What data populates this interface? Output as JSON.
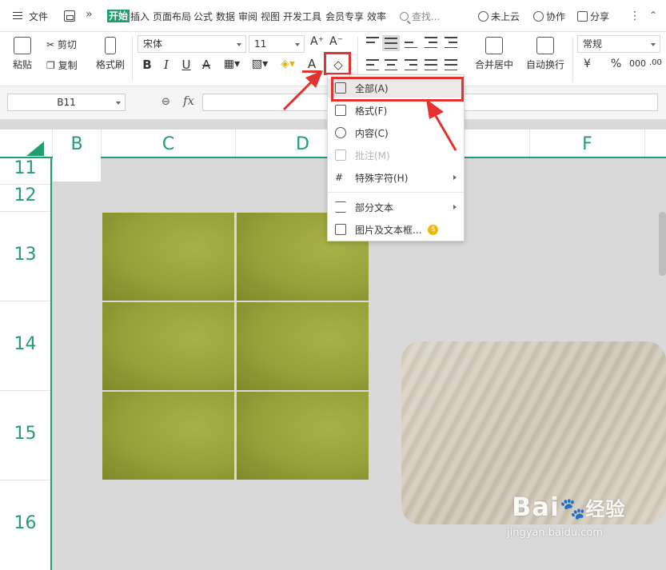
{
  "menubar": {
    "file_label": "文件",
    "more_label": "»",
    "tabs": [
      "开始",
      "插入",
      "页面布局",
      "公式",
      "数据",
      "审阅",
      "视图",
      "开发工具",
      "会员专享",
      "效率"
    ],
    "search_placeholder": "查找...",
    "cloud_label": "未上云",
    "collab_label": "协作",
    "share_label": "分享",
    "kebab": "⋮",
    "collapse": "⌃"
  },
  "ribbon": {
    "paste_label": "粘贴",
    "cut_label": "剪切",
    "copy_label": "复制",
    "format_painter_label": "格式刷",
    "font_name": "宋体",
    "font_size": "11",
    "grow_font": "A⁺",
    "shrink_font": "A⁻",
    "bold": "B",
    "italic": "I",
    "underline": "U",
    "strike": "A",
    "font_color_glyph": "A",
    "clear_glyph": "◇",
    "merge_label": "合并居中",
    "wrap_label": "自动换行",
    "number_format": "常规",
    "currency": "¥",
    "percent": "%",
    "thousands": "000",
    "inc_decimal": "←.0",
    "dec_decimal": ".00"
  },
  "formula_bar": {
    "cell_ref": "B11",
    "fx_label": "fx",
    "zoom_glyph": "⊖"
  },
  "grid": {
    "columns": [
      {
        "label": "B"
      },
      {
        "label": "C"
      },
      {
        "label": "D"
      },
      {
        "label": "F"
      }
    ],
    "rows": [
      {
        "label": "11"
      },
      {
        "label": "12"
      },
      {
        "label": "13"
      },
      {
        "label": "14"
      },
      {
        "label": "15"
      },
      {
        "label": "16"
      }
    ]
  },
  "clear_menu": {
    "items": [
      {
        "label": "全部(A)",
        "icon": "clear-all-icon",
        "active": true
      },
      {
        "label": "格式(F)",
        "icon": "clear-format-icon"
      },
      {
        "label": "内容(C)",
        "icon": "clear-content-icon"
      },
      {
        "label": "批注(M)",
        "icon": "clear-comment-icon",
        "disabled": true
      },
      {
        "label": "特殊字符(H)",
        "icon": "special-char-icon",
        "submenu": true
      },
      {
        "label": "部分文本",
        "icon": "partial-text-icon",
        "submenu": true
      },
      {
        "label": "图片及文本框...",
        "icon": "picture-textbox-icon",
        "premium": true
      }
    ]
  },
  "watermark": {
    "brand": "Bai",
    "brand2": "经验",
    "url": "jingyan.baidu.com"
  },
  "colors": {
    "accent": "#1e9f6b",
    "annotation": "#e5322e",
    "premium_coin": "#f5b800"
  }
}
